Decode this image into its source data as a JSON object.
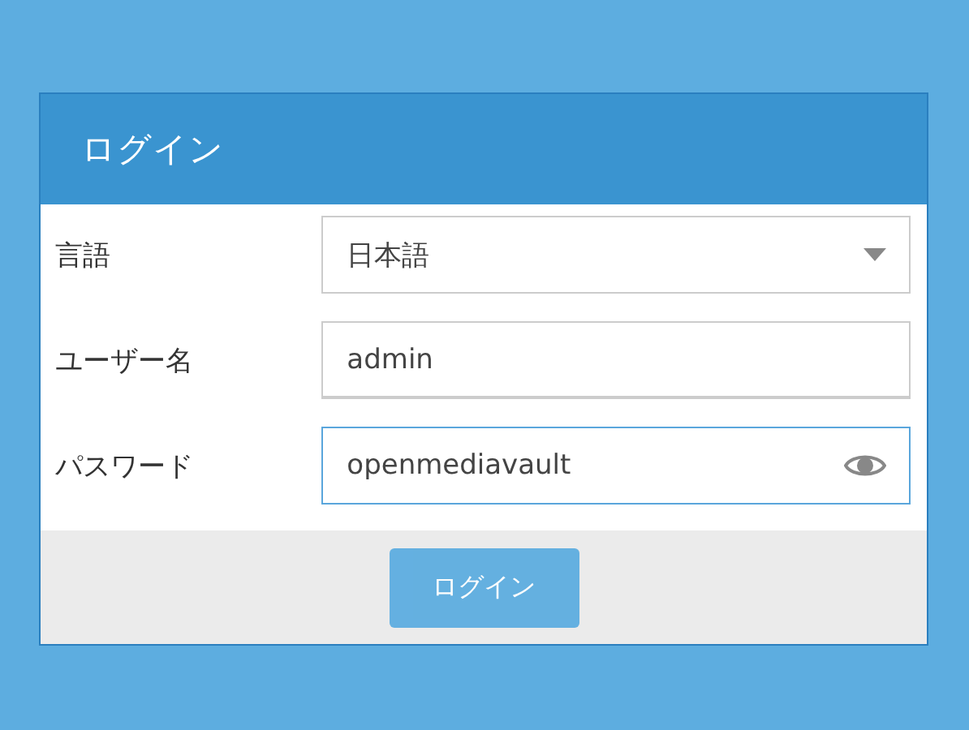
{
  "dialog": {
    "title": "ログイン"
  },
  "fields": [
    {
      "kind": "select",
      "label": "言語",
      "value": "日本語",
      "focused": false
    },
    {
      "kind": "text",
      "label": "ユーザー名",
      "value": "admin",
      "focused": false
    },
    {
      "kind": "password",
      "label": "パスワード",
      "value": "openmediavault",
      "focused": true
    }
  ],
  "buttons": [
    {
      "label": "ログイン",
      "disabled": true
    }
  ]
}
